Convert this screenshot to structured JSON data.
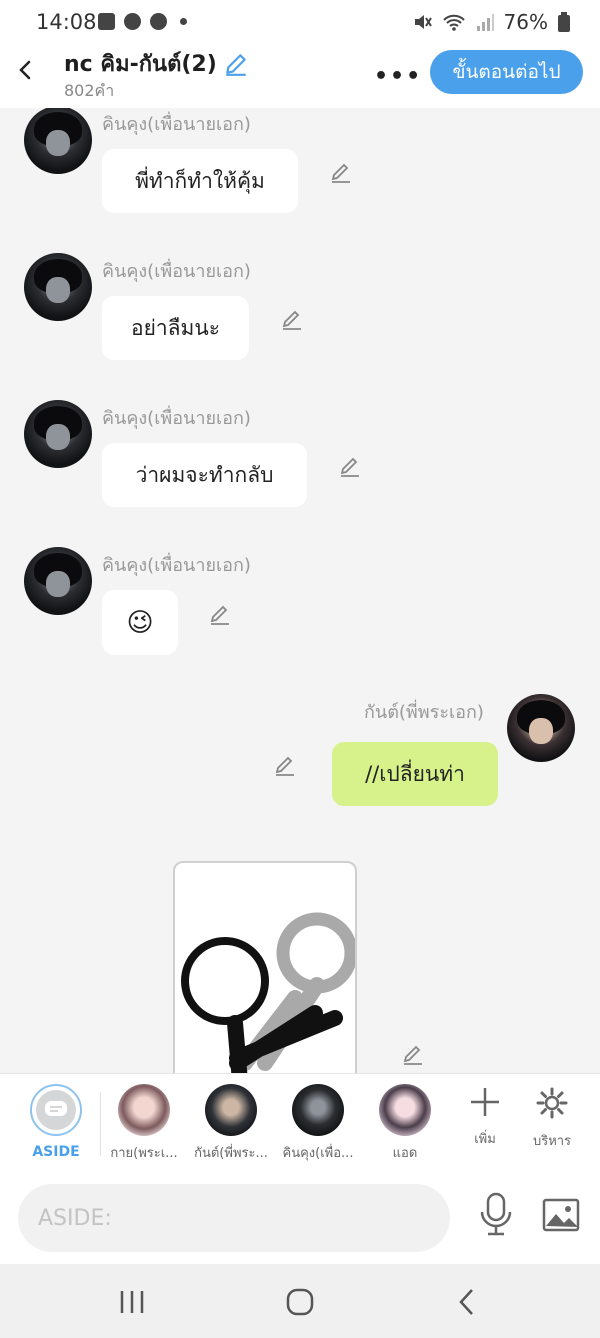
{
  "status_bar": {
    "time": "14:08",
    "battery": "76%"
  },
  "header": {
    "title": "nc คิม-กันต์(2)",
    "word_count": "802คำ",
    "more": "•••",
    "next_button": "ขั้นตอนต่อไป"
  },
  "messages": [
    {
      "sender": "คินคุง(เพื่อนายเอก)",
      "text": "พี่ทำก็ทำให้คุ้ม",
      "side": "left"
    },
    {
      "sender": "คินคุง(เพื่อนายเอก)",
      "text": "อย่าลืมนะ",
      "side": "left"
    },
    {
      "sender": "คินคุง(เพื่อนายเอก)",
      "text": "ว่าผมจะทำกลับ",
      "side": "left"
    },
    {
      "sender": "คินคุง(เพื่อนายเอก)",
      "text": "😉",
      "side": "left"
    },
    {
      "sender": "กันต์(พี่พระเอก)",
      "text": "//เปลี่ยนท่า",
      "side": "right"
    }
  ],
  "characters": {
    "aside_label": "ASIDE",
    "items": [
      {
        "label": "กาย(พระเ..."
      },
      {
        "label": "กันต์(พี่พระ..."
      },
      {
        "label": "คินคุง(เพื่อ..."
      },
      {
        "label": "แอด"
      }
    ],
    "add_label": "เพิ่ม",
    "manage_label": "บริหาร"
  },
  "input": {
    "placeholder": "ASIDE:"
  },
  "colors": {
    "accent": "#4aa0ea",
    "right_bubble": "#d7f18b",
    "left_bubble": "#ffffff"
  }
}
